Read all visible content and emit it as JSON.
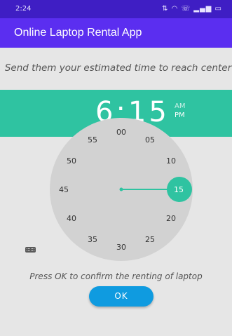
{
  "status_bar": {
    "time": "2:24",
    "icons": [
      "data-icon",
      "wifi-icon",
      "call-icon",
      "signal-icon",
      "battery-icon"
    ]
  },
  "app_bar": {
    "title": "Online Laptop Rental App"
  },
  "prompt": "Send them your estimated time to reach center",
  "time_picker": {
    "time": "6:15",
    "am_label": "AM",
    "pm_label": "PM",
    "selected_period": "PM",
    "dial_labels": [
      "00",
      "05",
      "10",
      "15",
      "20",
      "25",
      "30",
      "35",
      "40",
      "45",
      "50",
      "55"
    ],
    "selected_minute": "15",
    "accent_color": "#2fc3a1"
  },
  "confirm_text": "Press OK to confirm the renting of laptop",
  "ok_label": "OK"
}
